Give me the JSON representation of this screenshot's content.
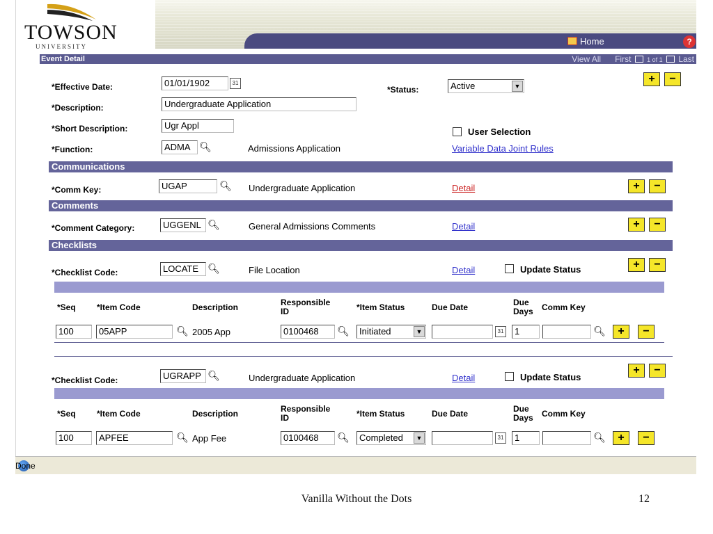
{
  "header": {
    "logo_text": "TOWSON",
    "logo_sub": "UNIVERSITY",
    "home_label": "Home",
    "help_label": "?"
  },
  "event": {
    "section_title": "Event Detail",
    "view_all": "View All",
    "first": "First",
    "count": "1 of 1",
    "last": "Last"
  },
  "form": {
    "effective_date_label": "*Effective Date:",
    "effective_date_value": "01/01/1902",
    "status_label": "*Status:",
    "status_value": "Active",
    "description_label": "*Description:",
    "description_value": "Undergraduate Application",
    "short_desc_label": "*Short Description:",
    "short_desc_value": "Ugr Appl",
    "user_selection_label": "User Selection",
    "function_label": "*Function:",
    "function_value": "ADMA",
    "function_desc": "Admissions Application",
    "variable_link": "Variable Data Joint Rules"
  },
  "communications": {
    "title": "Communications",
    "comm_key_label": "*Comm Key:",
    "comm_key_value": "UGAP",
    "comm_key_desc": "Undergraduate Application",
    "detail": "Detail"
  },
  "comments": {
    "title": "Comments",
    "category_label": "*Comment Category:",
    "category_value": "UGGENL",
    "category_desc": "General Admissions Comments",
    "detail": "Detail"
  },
  "checklists": {
    "title": "Checklists",
    "code_label": "*Checklist Code:",
    "update_status_label": "Update Status",
    "detail": "Detail",
    "columns": {
      "seq": "*Seq",
      "item_code": "*Item Code",
      "description": "Description",
      "resp_id_1": "Responsible",
      "resp_id_2": "ID",
      "item_status": "*Item Status",
      "due_date": "Due Date",
      "due_days_1": "Due",
      "due_days_2": "Days",
      "comm_key": "Comm Key"
    },
    "items": [
      {
        "code": "LOCATE",
        "desc": "File Location",
        "row": {
          "seq": "100",
          "item_code": "05APP",
          "description": "2005 App",
          "resp_id": "0100468",
          "status": "Initiated",
          "due_date": "",
          "due_days": "1",
          "comm_key": ""
        }
      },
      {
        "code": "UGRAPP",
        "desc": "Undergraduate Application",
        "row": {
          "seq": "100",
          "item_code": "APFEE",
          "description": "App Fee",
          "resp_id": "0100468",
          "status": "Completed",
          "due_date": "",
          "due_days": "1",
          "comm_key": ""
        }
      }
    ]
  },
  "buttons": {
    "plus": "+",
    "minus": "−"
  },
  "status_bar": {
    "text": "Done"
  },
  "footer": {
    "title": "Vanilla Without the Dots",
    "page": "12"
  }
}
